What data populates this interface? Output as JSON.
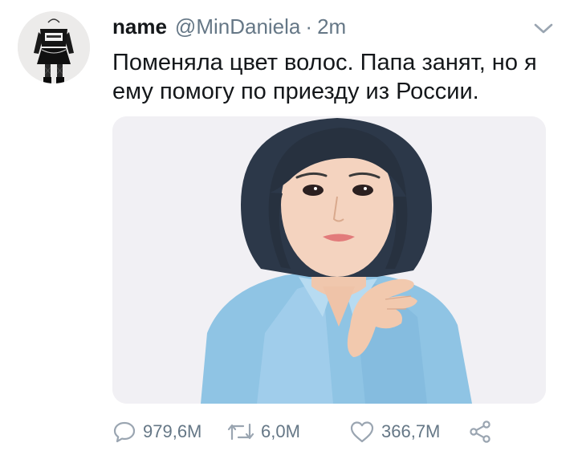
{
  "user": {
    "display_name": "name",
    "handle": "@MinDaniela",
    "separator": "·",
    "time": "2m"
  },
  "tweet": {
    "text": "Поменяла цвет волос. Папа занят, но я\nему помогу по приезду из России."
  },
  "actions": {
    "reply_count": "979,6M",
    "retweet_count": "6,0M",
    "like_count": "366,7M"
  },
  "icons": {
    "menu": "chevron-down-icon",
    "reply": "speech-bubble-icon",
    "retweet": "retweet-arrows-icon",
    "like": "heart-icon",
    "share": "share-nodes-icon"
  },
  "colors": {
    "text": "#14171a",
    "secondary": "#657786",
    "icon": "#9aa5b1"
  }
}
